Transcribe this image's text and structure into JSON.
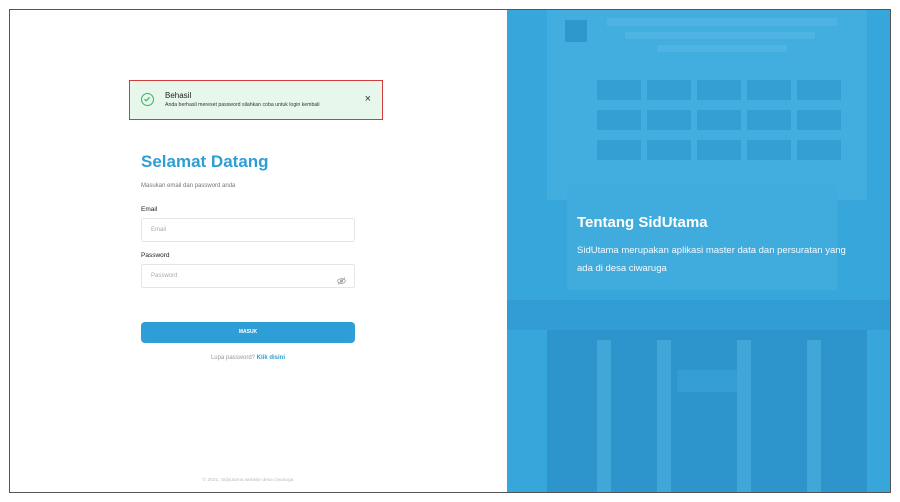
{
  "toast": {
    "title": "Behasil",
    "message": "Anda berhasil mereset password silahkan coba untuk login kembali",
    "close_symbol": "×"
  },
  "login": {
    "heading": "Selamat Datang",
    "subheading": "Masukan email dan password anda",
    "email_label": "Email",
    "email_placeholder": "Email",
    "password_label": "Password",
    "password_placeholder": "Password",
    "submit_label": "MASUK",
    "forgot_text": "Lupa password?",
    "forgot_link": "Klik disini",
    "footer": "© 2021, Sidyutama website desa ciwaruga"
  },
  "info": {
    "heading": "Tentang SidUtama",
    "text": "SidUtama merupakan aplikasi master data dan persuratan yang ada di desa ciwaruga"
  },
  "colors": {
    "primary": "#2e9ed6",
    "panel": "#3aa8db",
    "toast_bg": "#e8f7ec",
    "toast_border": "#d43b3b",
    "success": "#37b266"
  }
}
